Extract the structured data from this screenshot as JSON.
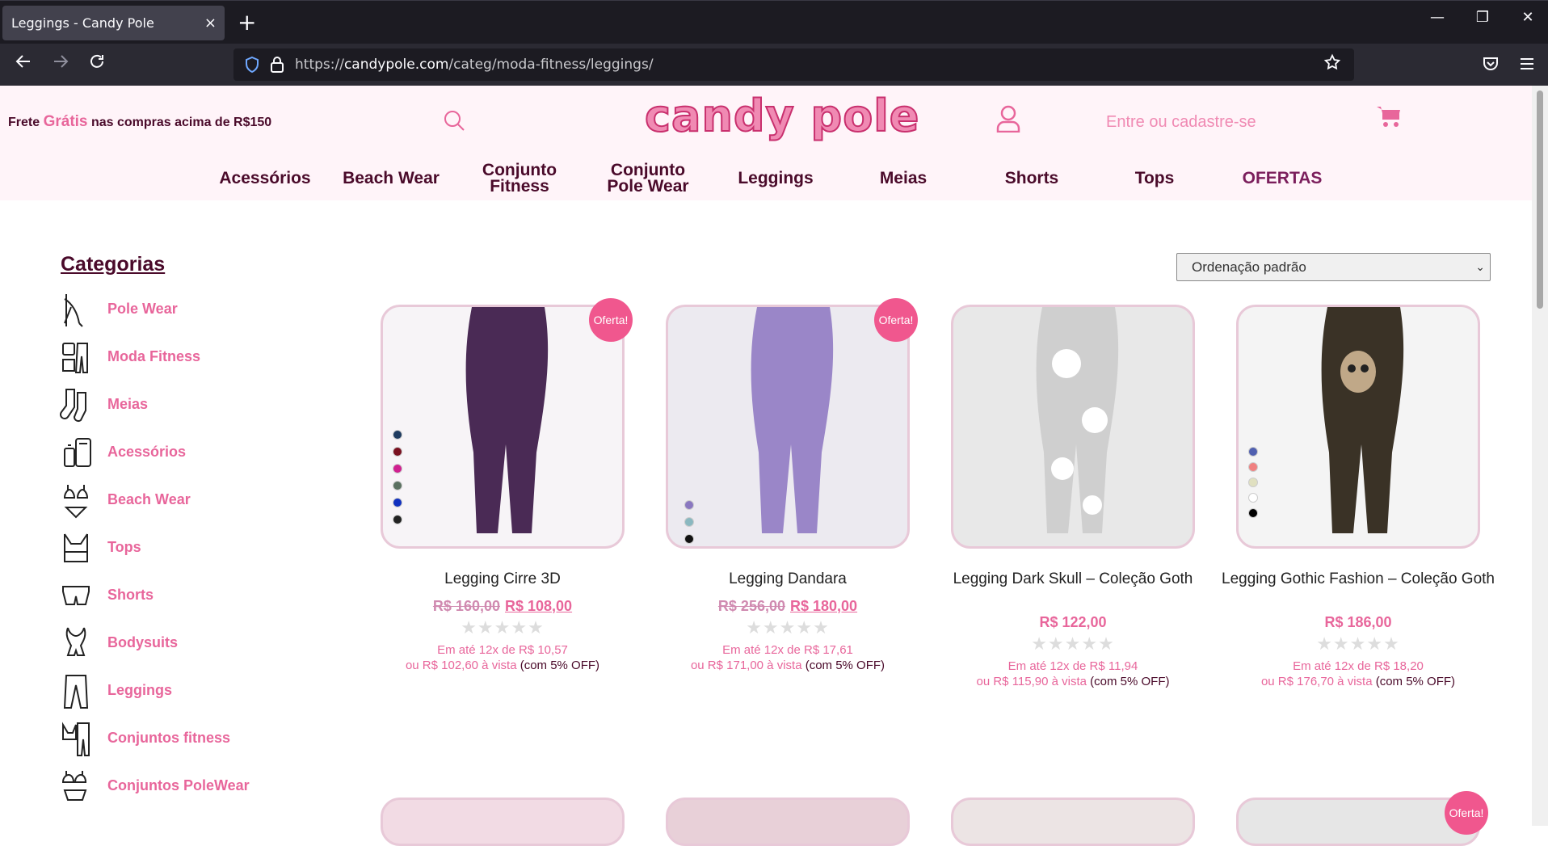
{
  "browser": {
    "tab_title": "Leggings - Candy Pole",
    "tab_close": "×",
    "new_tab": "+",
    "url_prefix": "https://",
    "url_domain": "candypole.com",
    "url_path": "/categ/moda-fitness/leggings/",
    "win_min": "—",
    "win_restore": "❐",
    "win_close": "✕"
  },
  "header": {
    "promo_pre": "Frete ",
    "promo_highlight": "Grátis",
    "promo_post": " nas compras acima de R$150",
    "logo": "candy pole",
    "login": "Entre ou cadastre-se"
  },
  "menu": [
    {
      "label": "Acessórios"
    },
    {
      "label": "Beach Wear"
    },
    {
      "label": "Conjunto Fitness"
    },
    {
      "label": "Conjunto Pole Wear"
    },
    {
      "label": "Leggings"
    },
    {
      "label": "Meias"
    },
    {
      "label": "Shorts"
    },
    {
      "label": "Tops"
    },
    {
      "label": "OFERTAS"
    }
  ],
  "sidebar": {
    "title": "Categorias",
    "items": [
      {
        "label": "Pole Wear",
        "icon": "pole-wear-icon"
      },
      {
        "label": "Moda Fitness",
        "icon": "fitness-icon"
      },
      {
        "label": "Meias",
        "icon": "socks-icon"
      },
      {
        "label": "Acessórios",
        "icon": "accessories-icon"
      },
      {
        "label": "Beach Wear",
        "icon": "bikini-icon"
      },
      {
        "label": "Tops",
        "icon": "top-icon"
      },
      {
        "label": "Shorts",
        "icon": "shorts-icon"
      },
      {
        "label": "Bodysuits",
        "icon": "bodysuit-icon"
      },
      {
        "label": "Leggings",
        "icon": "leggings-icon"
      },
      {
        "label": "Conjuntos fitness",
        "icon": "fitness-set-icon"
      },
      {
        "label": "Conjuntos PoleWear",
        "icon": "polewear-set-icon"
      }
    ]
  },
  "sort": {
    "selected": "Ordenação padrão"
  },
  "products": [
    {
      "name": "Legging Cirre 3D",
      "old_price": "R$ 160,00",
      "price": "R$ 108,00",
      "installments": "Em até 12x de R$ 10,57",
      "cash": "ou R$ 102,60 à vista",
      "discount": "(com 5% OFF)",
      "badge": "Oferta!",
      "swatches": [
        "#1e3a5f",
        "#7a1020",
        "#d02090",
        "#5a7060",
        "#1030c0",
        "#222222"
      ],
      "img_bg": "#f7f4f7",
      "garment": "#4a2a55"
    },
    {
      "name": "Legging Dandara",
      "old_price": "R$ 256,00",
      "price": "R$ 180,00",
      "installments": "Em até 12x de R$ 17,61",
      "cash": "ou R$ 171,00 à vista",
      "discount": "(com 5% OFF)",
      "badge": "Oferta!",
      "swatches": [
        "#8a78c0",
        "#8ab8c0",
        "#111111"
      ],
      "img_bg": "#eceaf0",
      "garment": "#9a86c8"
    },
    {
      "name": "Legging Dark Skull – Coleção Goth",
      "old_price": "",
      "price": "R$ 122,00",
      "installments": "Em até 12x de R$ 11,94",
      "cash": "ou R$ 115,90 à vista",
      "discount": "(com 5% OFF)",
      "badge": "",
      "swatches": [],
      "img_bg": "#e8e8e8",
      "garment": "#cfcfcf"
    },
    {
      "name": "Legging Gothic Fashion – Coleção Goth",
      "old_price": "",
      "price": "R$ 186,00",
      "installments": "Em até 12x de R$ 18,20",
      "cash": "ou R$ 176,70 à vista",
      "discount": "(com 5% OFF)",
      "badge": "",
      "swatches": [
        "#5060b0",
        "#f08080",
        "#e0e0c0",
        "#ffffff",
        "#000000"
      ],
      "img_bg": "#f4f4f4",
      "garment": "#3a3226"
    }
  ],
  "second_row_badge": "Oferta!",
  "stars": "★★★★★",
  "colors": {
    "accent": "#e8669b",
    "dark": "#4a0a2a",
    "header_bg": "#fff4f9"
  }
}
